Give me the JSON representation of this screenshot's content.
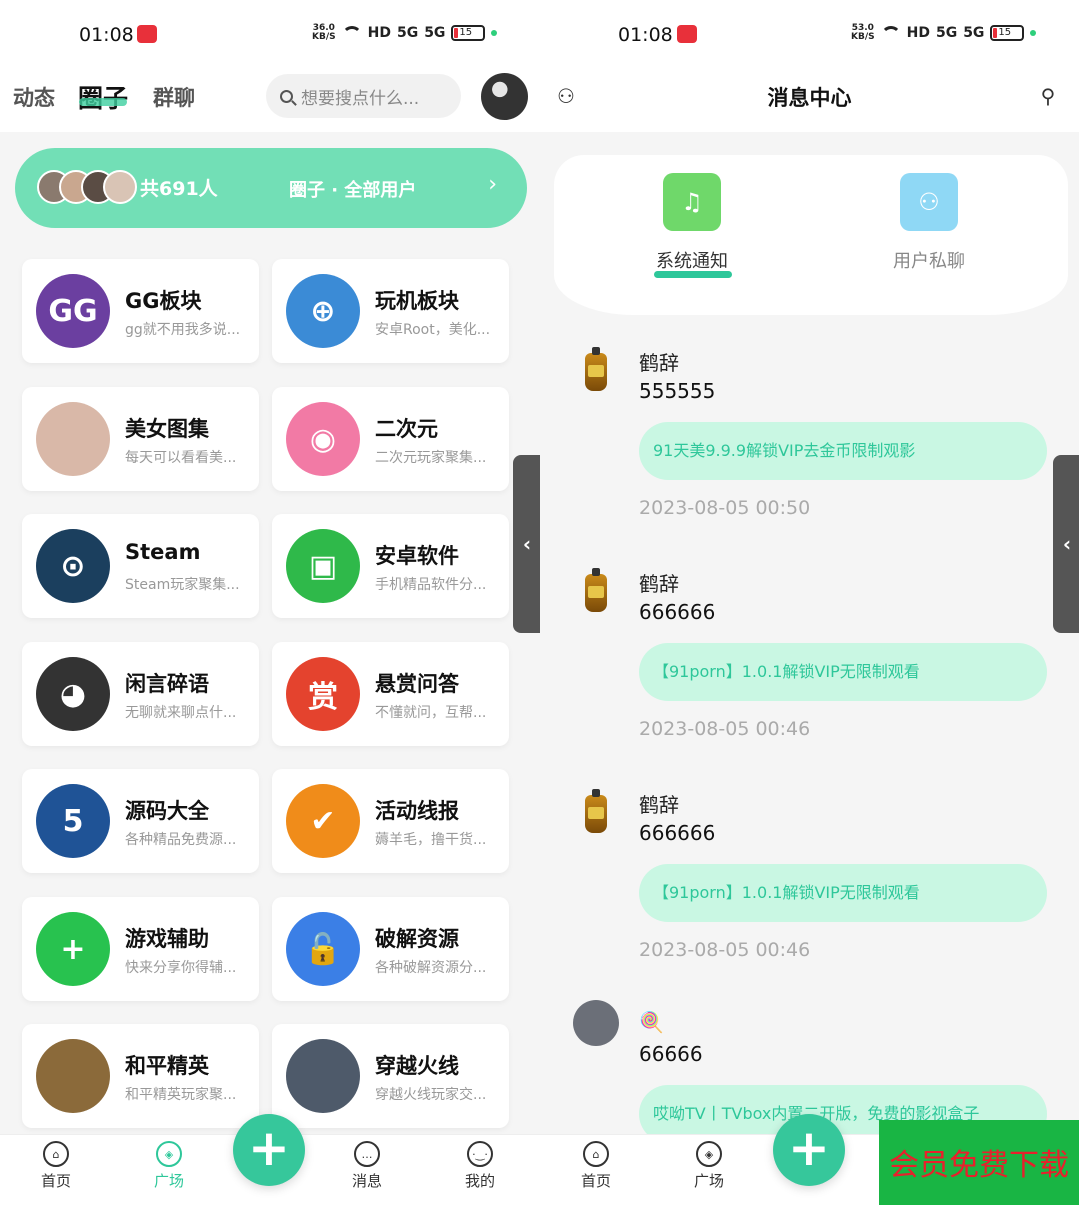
{
  "status_left": {
    "time": "01:08",
    "speed_top": "36.0",
    "speed_bottom": "KB/S",
    "hd": "HD",
    "sig1": "5G",
    "sig2": "5G",
    "battery": "15"
  },
  "status_right": {
    "time": "01:08",
    "speed_top": "53.0",
    "speed_bottom": "KB/S",
    "hd": "HD",
    "sig1": "5G",
    "sig2": "5G",
    "battery": "15"
  },
  "left": {
    "tabs": [
      "动态",
      "圈子",
      "群聊"
    ],
    "active_tab": "圈子",
    "search_placeholder": "想要搜点什么...",
    "banner": {
      "count": "共691人",
      "title": "圈子 · 全部用户",
      "arrow": "›"
    },
    "circles": [
      {
        "name": "GG板块",
        "desc": "gg就不用我多说...",
        "icon": "gg-icon",
        "color": "#6b3fa0",
        "glyph": "GG"
      },
      {
        "name": "玩机板块",
        "desc": "安卓Root，美化...",
        "icon": "gamepad-icon",
        "color": "#3b8bd6",
        "glyph": "⊕"
      },
      {
        "name": "美女图集",
        "desc": "每天可以看看美...",
        "icon": "photo-avatar-icon",
        "color": "#d9b8a8",
        "glyph": ""
      },
      {
        "name": "二次元",
        "desc": "二次元玩家聚集...",
        "icon": "anime-icon",
        "color": "#f27aa5",
        "glyph": "◉"
      },
      {
        "name": "Steam",
        "desc": "Steam玩家聚集...",
        "icon": "steam-icon",
        "color": "#1b3f5e",
        "glyph": "⊙"
      },
      {
        "name": "安卓软件",
        "desc": "手机精品软件分...",
        "icon": "android-icon",
        "color": "#2fb94a",
        "glyph": "▣"
      },
      {
        "name": "闲言碎语",
        "desc": "无聊就来聊点什...",
        "icon": "panda-icon",
        "color": "#333333",
        "glyph": "◕"
      },
      {
        "name": "悬赏问答",
        "desc": "不懂就问，互帮...",
        "icon": "reward-icon",
        "color": "#e4432e",
        "glyph": "赏"
      },
      {
        "name": "源码大全",
        "desc": "各种精品免费源...",
        "icon": "html5-icon",
        "color": "#1f5396",
        "glyph": "5"
      },
      {
        "name": "活动线报",
        "desc": "薅羊毛，撸干货...",
        "icon": "badge-check-icon",
        "color": "#f08c1a",
        "glyph": "✔"
      },
      {
        "name": "游戏辅助",
        "desc": "快来分享你得辅...",
        "icon": "controller-icon",
        "color": "#28c24f",
        "glyph": "+"
      },
      {
        "name": "破解资源",
        "desc": "各种破解资源分...",
        "icon": "lock-icon",
        "color": "#3b7fe6",
        "glyph": "🔓"
      },
      {
        "name": "和平精英",
        "desc": "和平精英玩家聚...",
        "icon": "pubg-icon",
        "color": "#8b6a3a",
        "glyph": ""
      },
      {
        "name": "穿越火线",
        "desc": "穿越火线玩家交...",
        "icon": "cf-icon",
        "color": "#4e5a6a",
        "glyph": ""
      }
    ],
    "side_tab": "‹"
  },
  "right": {
    "title": "消息中心",
    "tabs": [
      {
        "label": "系统通知",
        "icon": "bell-icon",
        "color": "#6fd86a"
      },
      {
        "label": "用户私聊",
        "icon": "users-icon",
        "color": "#8fd8f5"
      }
    ],
    "messages": [
      {
        "name": "鹤辞",
        "text": "555555",
        "bubble": "91天美9.9.9解锁VIP去金币限制观影",
        "time": "2023-08-05 00:50",
        "avatar": "bottle-icon"
      },
      {
        "name": "鹤辞",
        "text": "666666",
        "bubble": "【91porn】1.0.1解锁VIP无限制观看",
        "time": "2023-08-05 00:46",
        "avatar": "bottle-icon"
      },
      {
        "name": "鹤辞",
        "text": "666666",
        "bubble": "【91porn】1.0.1解锁VIP无限制观看",
        "time": "2023-08-05 00:46",
        "avatar": "bottle-icon"
      },
      {
        "name": "🍭",
        "text": "66666",
        "bubble": "哎呦TV丨TVbox内置二开版，免费的影视盒子",
        "time": "",
        "avatar": "photo-avatar-icon"
      }
    ],
    "side_tab": "‹"
  },
  "nav_left": [
    "首页",
    "广场",
    "消息",
    "我的"
  ],
  "nav_right": [
    "首页",
    "广场"
  ],
  "fab": "+",
  "vip_label": "会员免费下载"
}
